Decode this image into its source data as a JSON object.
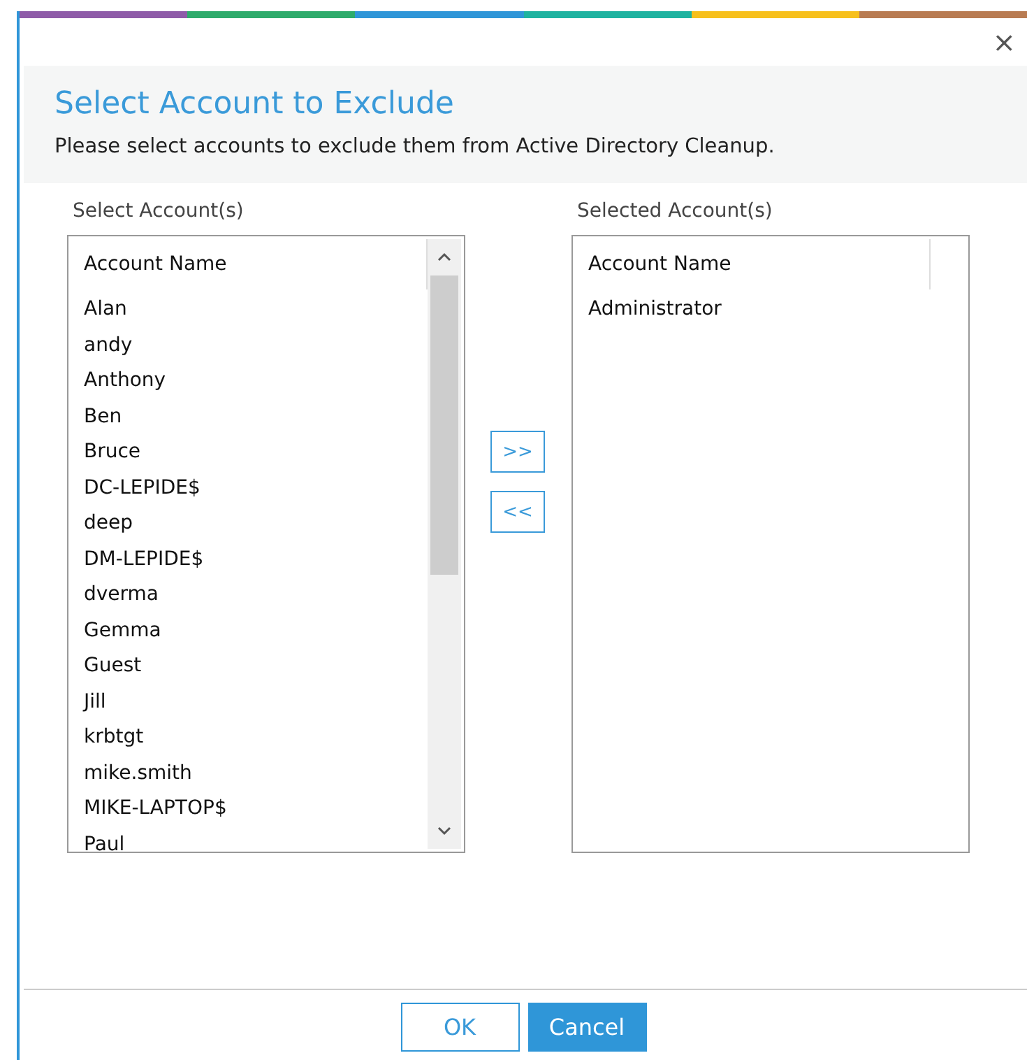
{
  "window": {
    "title": "Select Account to Exclude",
    "subtitle": "Please select accounts to exclude them from Active Directory Cleanup.",
    "close": "×"
  },
  "accent_stripes": [
    {
      "color": "#8e5ba8"
    },
    {
      "color": "#2eab6b"
    },
    {
      "color": "#2f96d8"
    },
    {
      "color": "#1fb3a0"
    },
    {
      "color": "#f7c01c"
    },
    {
      "color": "#b87b52"
    }
  ],
  "available": {
    "label": "Select Account(s)",
    "column": "Account Name",
    "rows": [
      "Alan",
      "andy",
      "Anthony",
      "Ben",
      "Bruce",
      "DC-LEPIDE$",
      "deep",
      "DM-LEPIDE$",
      "dverma",
      "Gemma",
      "Guest",
      "Jill",
      "krbtgt",
      "mike.smith",
      "MIKE-LAPTOP$",
      "Paul"
    ]
  },
  "move_buttons": [
    ">>",
    "<<"
  ],
  "selected": {
    "label": "Selected Account(s)",
    "column": "Account Name",
    "rows": [
      "Administrator"
    ]
  },
  "buttons": [
    {
      "label": "OK",
      "kind": "secondary"
    },
    {
      "label": "Cancel",
      "kind": "primary"
    }
  ]
}
